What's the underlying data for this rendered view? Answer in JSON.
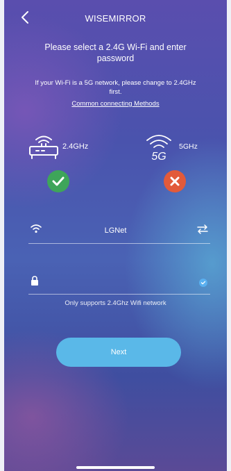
{
  "header": {
    "title": "WISEMIRROR",
    "back_icon": "chevron-left-icon"
  },
  "instructions": {
    "headline": "Please select a 2.4G Wi-Fi and enter password",
    "note": "If your Wi-Fi is a 5G network, please change to 2.4GHz first.",
    "link": "Common connecting Methods"
  },
  "bands": {
    "band_24": {
      "label": "2.4GHz",
      "status_icon": "check-icon",
      "status_color": "#3ea55a"
    },
    "band_5": {
      "label": "5GHz",
      "icon_text": "5G",
      "status_icon": "cross-icon",
      "status_color": "#e25a3a"
    }
  },
  "network": {
    "ssid": "LGNet",
    "wifi_icon": "wifi-icon",
    "swap_icon": "swap-icon"
  },
  "password": {
    "value": "",
    "lock_icon": "lock-icon",
    "visibility_icon": "eye-icon"
  },
  "hint": "Only supports 2.4Ghz Wifi network",
  "actions": {
    "next_label": "Next",
    "accent_color": "#5ab8e8"
  }
}
